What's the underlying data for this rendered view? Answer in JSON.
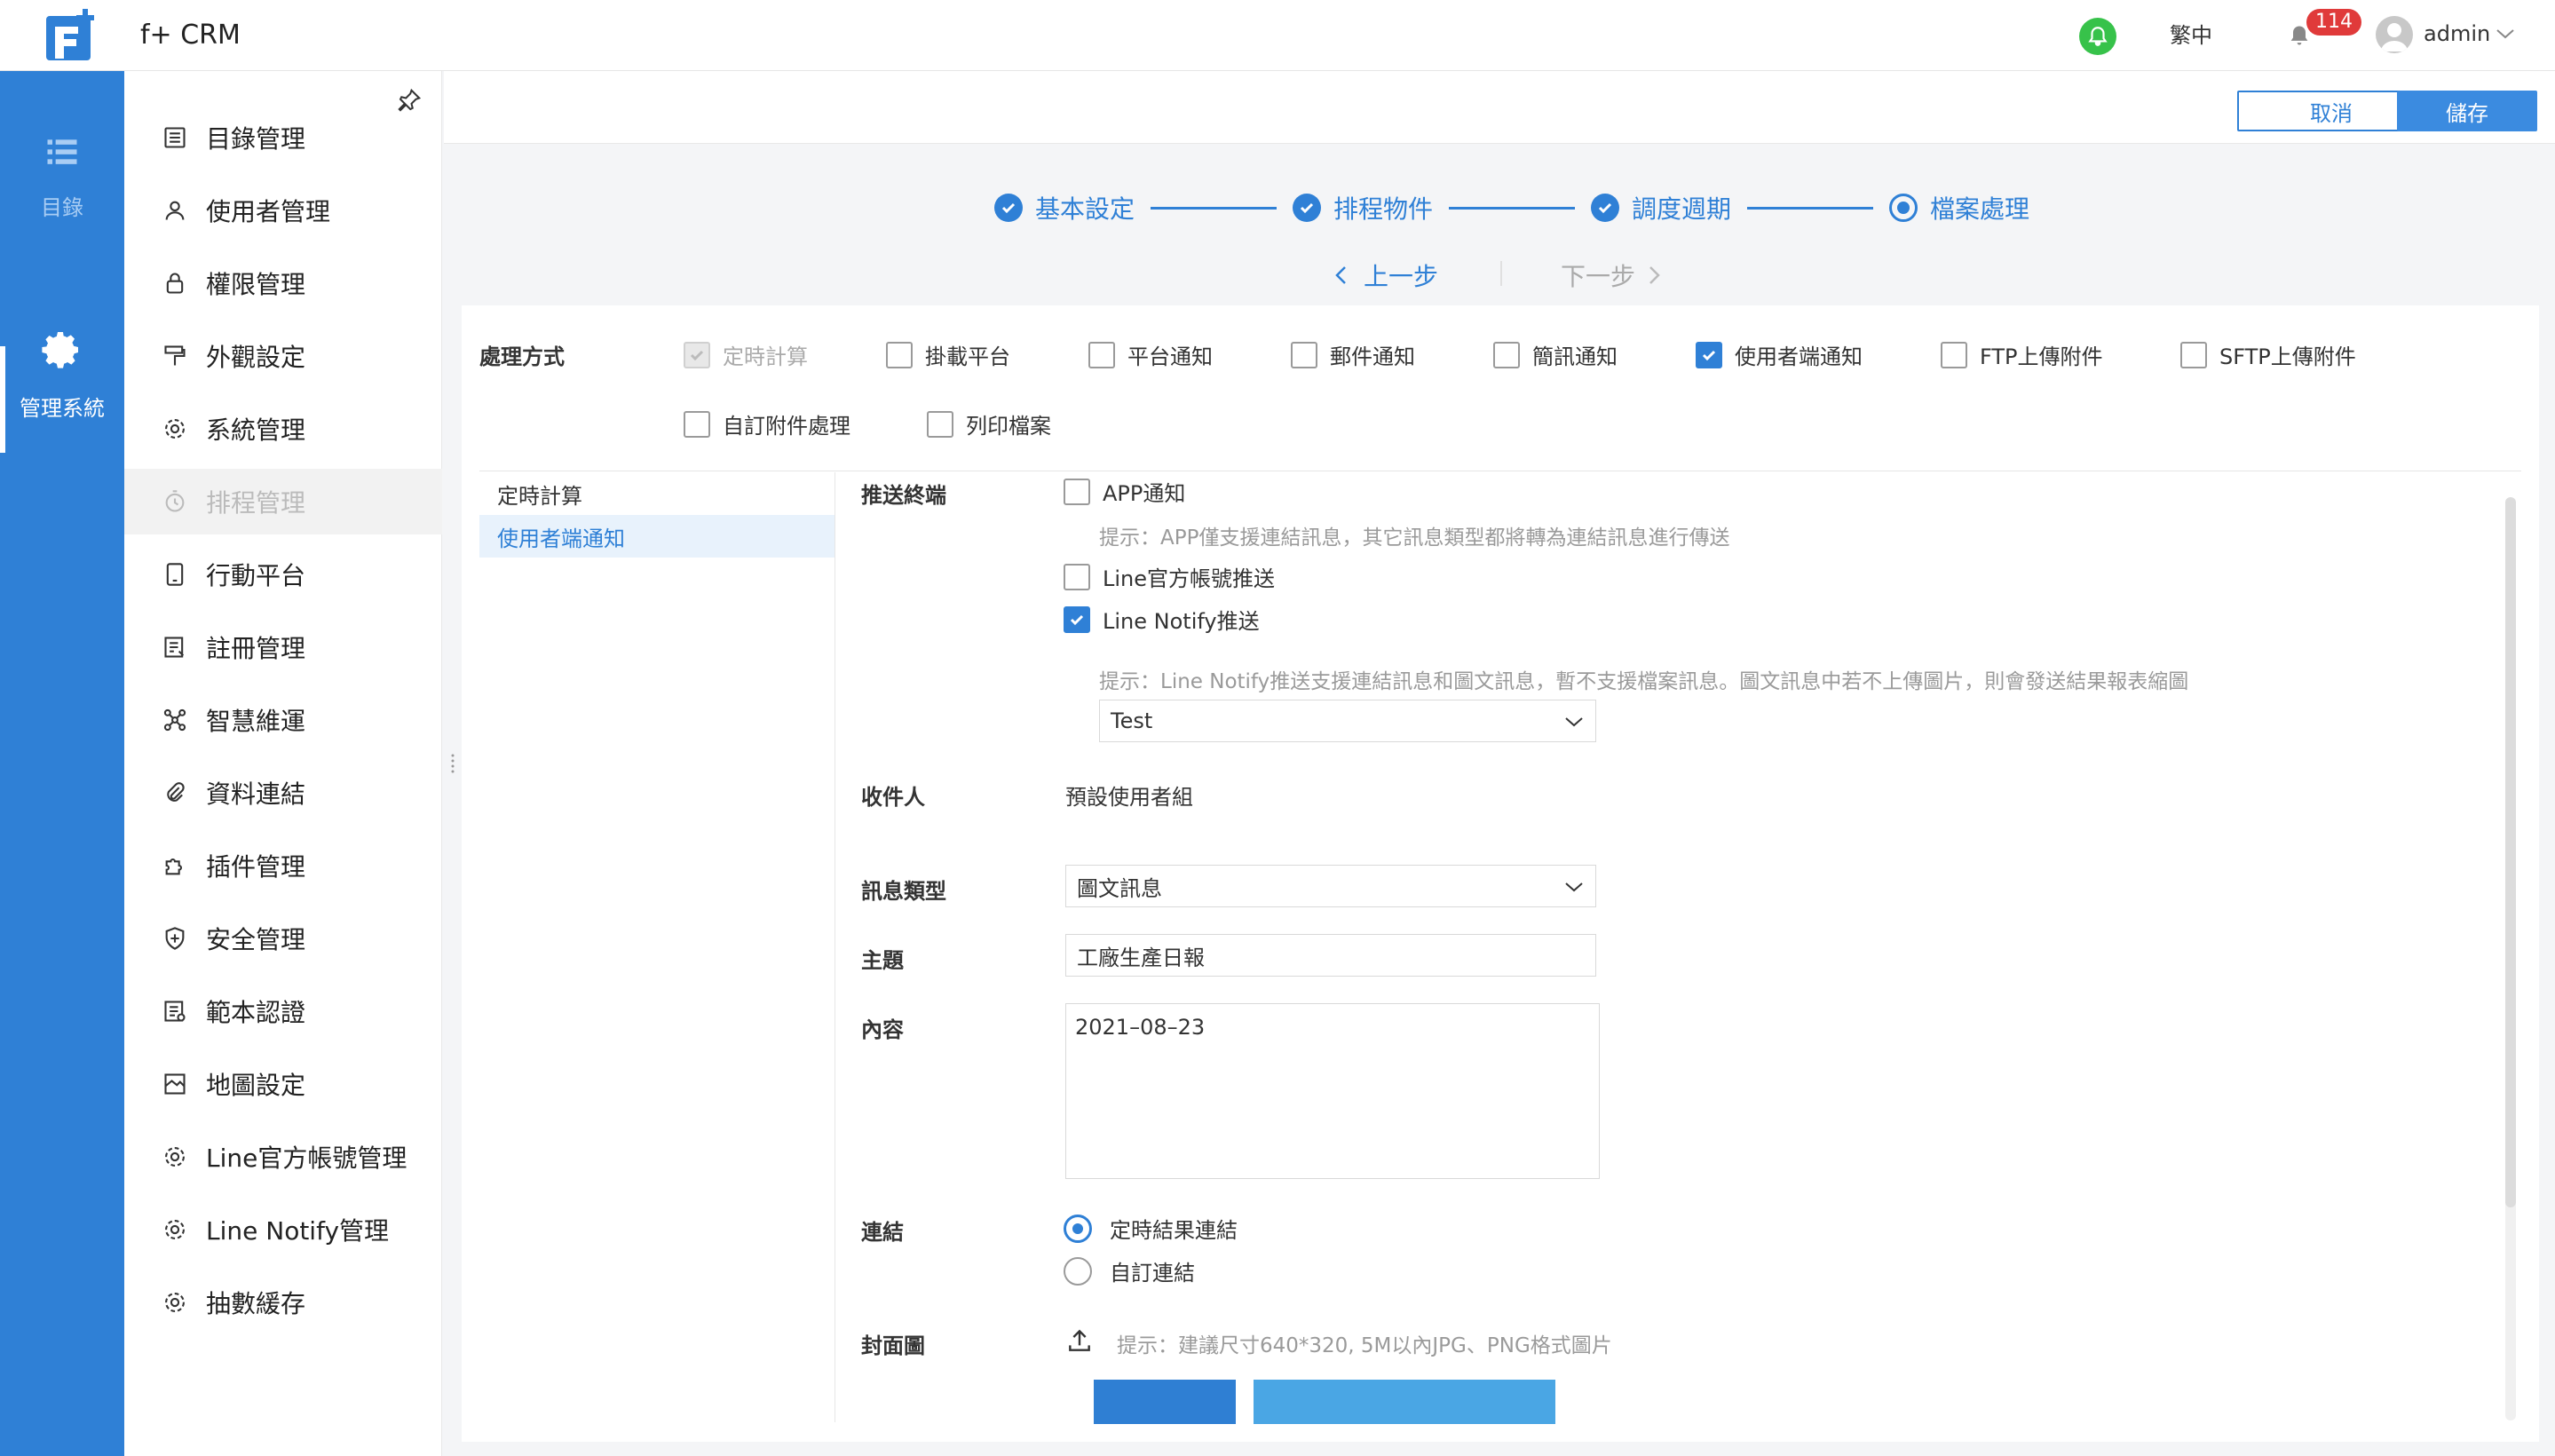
{
  "header": {
    "app_title": "f+ CRM",
    "language": "繁中",
    "notification_count": "114",
    "user_name": "admin"
  },
  "rail": {
    "directory_label": "目錄",
    "management_label": "管理系統"
  },
  "sidebar": {
    "items": [
      {
        "label": "目錄管理",
        "icon": "list-doc-icon"
      },
      {
        "label": "使用者管理",
        "icon": "user-icon"
      },
      {
        "label": "權限管理",
        "icon": "lock-icon"
      },
      {
        "label": "外觀設定",
        "icon": "paint-roller-icon"
      },
      {
        "label": "系統管理",
        "icon": "gear-icon"
      },
      {
        "label": "排程管理",
        "icon": "timer-icon"
      },
      {
        "label": "行動平台",
        "icon": "tablet-icon"
      },
      {
        "label": "註冊管理",
        "icon": "register-icon"
      },
      {
        "label": "智慧維運",
        "icon": "network-icon"
      },
      {
        "label": "資料連結",
        "icon": "paperclip-icon"
      },
      {
        "label": "插件管理",
        "icon": "puzzle-icon"
      },
      {
        "label": "安全管理",
        "icon": "shield-icon"
      },
      {
        "label": "範本認證",
        "icon": "template-icon"
      },
      {
        "label": "地圖設定",
        "icon": "map-icon"
      },
      {
        "label": "Line官方帳號管理",
        "icon": "gear-icon"
      },
      {
        "label": "Line Notify管理",
        "icon": "gear-icon"
      },
      {
        "label": "抽數緩存",
        "icon": "gear-icon"
      }
    ]
  },
  "toolbar": {
    "cancel_label": "取消",
    "save_label": "儲存"
  },
  "steps": [
    {
      "label": "基本設定",
      "state": "done"
    },
    {
      "label": "排程物件",
      "state": "done"
    },
    {
      "label": "調度週期",
      "state": "done"
    },
    {
      "label": "檔案處理",
      "state": "current"
    }
  ],
  "step_nav": {
    "prev": "上一步",
    "next": "下一步"
  },
  "processing": {
    "label": "處理方式",
    "options": [
      {
        "label": "定時計算",
        "checked": true,
        "disabled": true
      },
      {
        "label": "掛載平台",
        "checked": false
      },
      {
        "label": "平台通知",
        "checked": false
      },
      {
        "label": "郵件通知",
        "checked": false
      },
      {
        "label": "簡訊通知",
        "checked": false
      },
      {
        "label": "使用者端通知",
        "checked": true
      },
      {
        "label": "FTP上傳附件",
        "checked": false
      },
      {
        "label": "SFTP上傳附件",
        "checked": false
      },
      {
        "label": "自訂附件處理",
        "checked": false
      },
      {
        "label": "列印檔案",
        "checked": false
      }
    ]
  },
  "sublist": [
    "定時計算",
    "使用者端通知"
  ],
  "form": {
    "push_label": "推送終端",
    "app_notify": "APP通知",
    "app_hint": "提示：APP僅支援連結訊息，其它訊息類型都將轉為連結訊息進行傳送",
    "line_official": "Line官方帳號推送",
    "line_notify": "Line Notify推送",
    "line_hint": "提示：Line Notify推送支援連結訊息和圖文訊息，暫不支援檔案訊息。圖文訊息中若不上傳圖片，則會發送結果報表縮圖",
    "line_select_value": "Test",
    "recipient_label": "收件人",
    "recipient_value": "預設使用者組",
    "msg_type_label": "訊息類型",
    "msg_type_value": "圖文訊息",
    "subject_label": "主題",
    "subject_value": "工廠生產日報",
    "content_label": "內容",
    "content_value": "2021–08–23",
    "link_label": "連結",
    "link_option1": "定時結果連結",
    "link_option2": "自訂連結",
    "cover_label": "封面圖",
    "cover_hint": "提示：建議尺寸640*320, 5M以內JPG、PNG格式圖片"
  },
  "colors": {
    "brand": "#2f80d6",
    "rail": "#2f80d6",
    "badge": "#e03a3a",
    "online": "#37c24a"
  }
}
